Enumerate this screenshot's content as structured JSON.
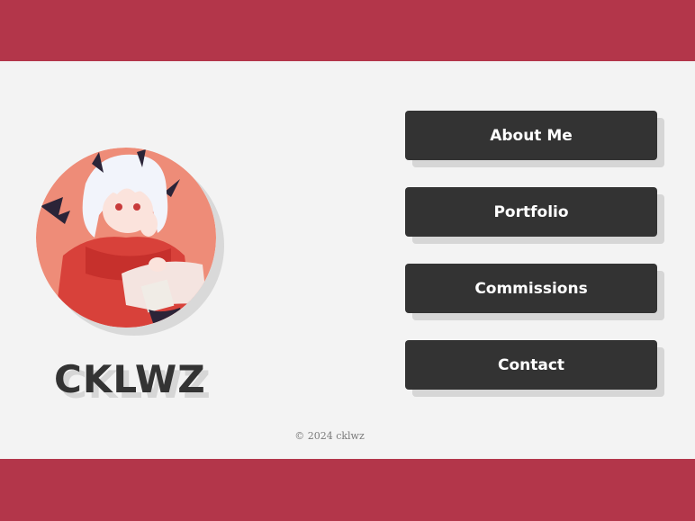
{
  "colors": {
    "band": "#b3364a",
    "background": "#f3f3f3",
    "button": "#333333",
    "button_text": "#ffffff"
  },
  "profile": {
    "avatar_alt": "Anime character with white hair and small demon horns wearing a red hoodie",
    "site_name": "CKLWZ"
  },
  "nav": {
    "items": [
      {
        "label": "About Me"
      },
      {
        "label": "Portfolio"
      },
      {
        "label": "Commissions"
      },
      {
        "label": "Contact"
      }
    ]
  },
  "footer": {
    "copyright": "© 2024 cklwz"
  }
}
